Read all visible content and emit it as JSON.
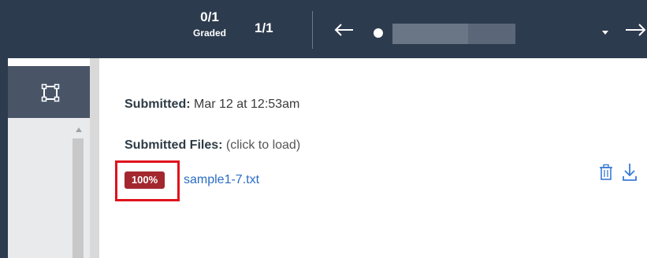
{
  "header": {
    "graded": {
      "count": "0/1",
      "label": "Graded"
    },
    "submission_count": "1/1",
    "prev_icon": "arrow-left-icon",
    "next_icon": "arrow-right-icon",
    "student_avatar_icon": "status-dot-icon",
    "dropdown_icon": "caret-down-icon"
  },
  "left_panel": {
    "fullscreen_icon": "fullscreen-icon"
  },
  "submission": {
    "submitted_label": "Submitted:",
    "submitted_value": "Mar 12 at 12:53am",
    "files_label": "Submitted Files:",
    "files_hint": "(click to load)",
    "files": [
      {
        "progress_badge": "100%",
        "name": "sample1-7.txt"
      }
    ],
    "delete_icon": "trash-icon",
    "download_icon": "download-icon"
  },
  "colors": {
    "header_bg": "#2d3b4e",
    "badge_bg": "#a3272f",
    "highlight": "#e0121c",
    "link": "#2b6cc4"
  }
}
